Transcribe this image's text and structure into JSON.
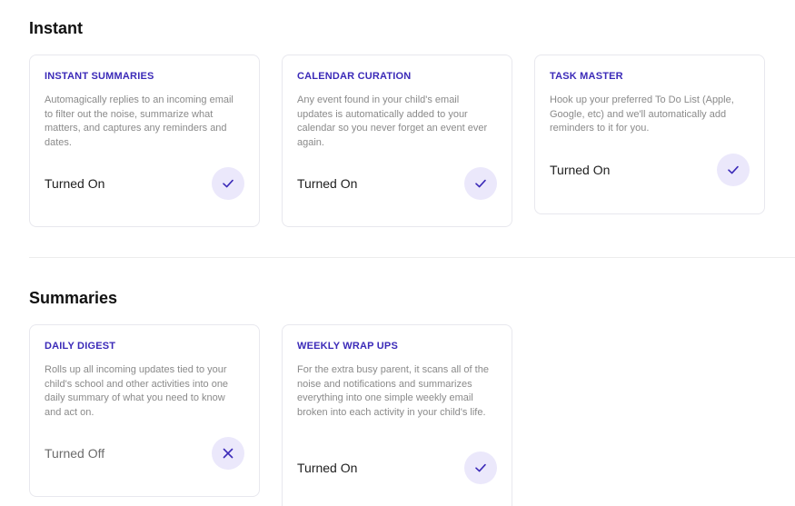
{
  "sections": [
    {
      "title": "Instant",
      "cards": [
        {
          "title": "INSTANT SUMMARIES",
          "description": "Automagically replies to an incoming email to filter out the noise, summarize what matters, and captures any reminders and dates.",
          "status": "Turned On",
          "icon": "check-icon"
        },
        {
          "title": "CALENDAR CURATION",
          "description": "Any event found in your child's email updates is automatically added to your calendar so you never forget an event ever again.",
          "status": "Turned On",
          "icon": "check-icon"
        },
        {
          "title": "TASK MASTER",
          "description": "Hook up your preferred To Do List (Apple, Google, etc) and we'll automatically add reminders to it for you.",
          "status": "Turned On",
          "icon": "check-icon"
        }
      ]
    },
    {
      "title": "Summaries",
      "cards": [
        {
          "title": "DAILY DIGEST",
          "description": "Rolls up all incoming updates tied to your child's school and other activities into one daily summary of what you need to know and act on.",
          "status": "Turned Off",
          "icon": "close-icon"
        },
        {
          "title": "WEEKLY WRAP UPS",
          "description": "For the extra busy parent, it scans all of the noise and notifications and summarizes everything into one simple weekly email broken into each activity in your child's life.",
          "status": "Turned On",
          "icon": "check-icon"
        }
      ]
    }
  ],
  "colors": {
    "accent": "#3b2ab8",
    "toggle_bg": "#ebe8fb"
  }
}
